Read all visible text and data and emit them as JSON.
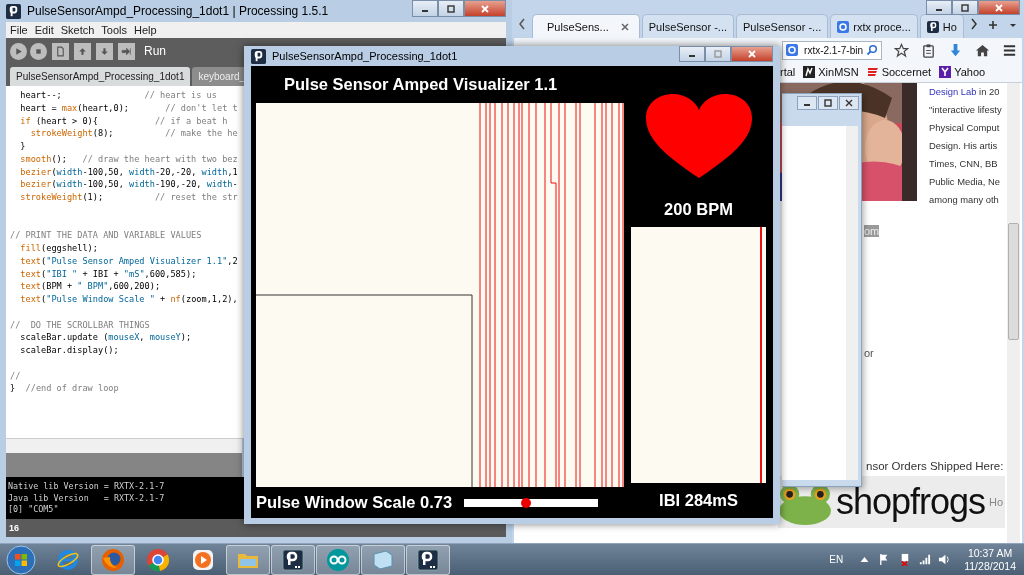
{
  "ide": {
    "title": "PulseSensorAmpd_Processing_1dot1 | Processing 1.5.1",
    "menu": [
      "File",
      "Edit",
      "Sketch",
      "Tools",
      "Help"
    ],
    "run_label": "Run",
    "tabs": [
      {
        "label": "PulseSensorAmpd_Processing_1dot1",
        "selected": true
      },
      {
        "label": "keyboard_",
        "selected": false
      }
    ],
    "code_blocks": [
      [
        [
          {
            "kind": "plain",
            "text": "  heart--;                "
          },
          {
            "kind": "comment",
            "text": "// heart is us"
          }
        ],
        [
          {
            "kind": "plain",
            "text": "  heart = "
          },
          {
            "kind": "keyword",
            "text": "max"
          },
          {
            "kind": "plain",
            "text": "(heart,0);       "
          },
          {
            "kind": "comment",
            "text": "// don't let t"
          }
        ],
        [
          {
            "kind": "keyword",
            "text": "  if"
          },
          {
            "kind": "plain",
            "text": " (heart > 0){           "
          },
          {
            "kind": "comment",
            "text": "// if a beat h"
          }
        ],
        [
          {
            "kind": "keyword",
            "text": "    strokeWeight"
          },
          {
            "kind": "plain",
            "text": "(8);          "
          },
          {
            "kind": "comment",
            "text": "// make the he"
          }
        ],
        [
          {
            "kind": "plain",
            "text": "  }"
          }
        ],
        [
          {
            "kind": "keyword",
            "text": "  smooth"
          },
          {
            "kind": "plain",
            "text": "();   "
          },
          {
            "kind": "comment",
            "text": "// draw the heart with two bez"
          }
        ],
        [
          {
            "kind": "keyword",
            "text": "  bezier"
          },
          {
            "kind": "plain",
            "text": "("
          },
          {
            "kind": "variable",
            "text": "width"
          },
          {
            "kind": "plain",
            "text": "-100,50, "
          },
          {
            "kind": "variable",
            "text": "width"
          },
          {
            "kind": "plain",
            "text": "-20,-20, "
          },
          {
            "kind": "variable",
            "text": "width"
          },
          {
            "kind": "plain",
            "text": ",1"
          }
        ],
        [
          {
            "kind": "keyword",
            "text": "  bezier"
          },
          {
            "kind": "plain",
            "text": "("
          },
          {
            "kind": "variable",
            "text": "width"
          },
          {
            "kind": "plain",
            "text": "-100,50, "
          },
          {
            "kind": "variable",
            "text": "width"
          },
          {
            "kind": "plain",
            "text": "-190,-20, "
          },
          {
            "kind": "variable",
            "text": "width"
          },
          {
            "kind": "plain",
            "text": "-"
          }
        ],
        [
          {
            "kind": "keyword",
            "text": "  strokeWeight"
          },
          {
            "kind": "plain",
            "text": "(1);          "
          },
          {
            "kind": "comment",
            "text": "// reset the str"
          }
        ]
      ],
      [
        [
          {
            "kind": "comment",
            "text": "// PRINT THE DATA AND VARIABLE VALUES"
          }
        ],
        [
          {
            "kind": "keyword",
            "text": "  fill"
          },
          {
            "kind": "plain",
            "text": "(eggshell);"
          }
        ],
        [
          {
            "kind": "keyword",
            "text": "  text"
          },
          {
            "kind": "plain",
            "text": "("
          },
          {
            "kind": "string",
            "text": "\"Pulse Sensor Amped Visualizer 1.1\""
          },
          {
            "kind": "plain",
            "text": ",2"
          }
        ],
        [
          {
            "kind": "keyword",
            "text": "  text"
          },
          {
            "kind": "plain",
            "text": "("
          },
          {
            "kind": "string",
            "text": "\"IBI \""
          },
          {
            "kind": "plain",
            "text": " + IBI + "
          },
          {
            "kind": "string",
            "text": "\"mS\""
          },
          {
            "kind": "plain",
            "text": ",600,585);"
          }
        ],
        [
          {
            "kind": "keyword",
            "text": "  text"
          },
          {
            "kind": "plain",
            "text": "(BPM + "
          },
          {
            "kind": "string",
            "text": "\" BPM\""
          },
          {
            "kind": "plain",
            "text": ",600,200);"
          }
        ],
        [
          {
            "kind": "keyword",
            "text": "  text"
          },
          {
            "kind": "plain",
            "text": "("
          },
          {
            "kind": "string",
            "text": "\"Pulse Window Scale \""
          },
          {
            "kind": "plain",
            "text": " + "
          },
          {
            "kind": "keyword",
            "text": "nf"
          },
          {
            "kind": "plain",
            "text": "(zoom,1,2),"
          }
        ]
      ],
      [
        [
          {
            "kind": "comment",
            "text": "//  DO THE SCROLLBAR THINGS"
          }
        ],
        [
          {
            "kind": "plain",
            "text": "  scaleBar.update ("
          },
          {
            "kind": "variable",
            "text": "mouseX"
          },
          {
            "kind": "plain",
            "text": ", "
          },
          {
            "kind": "variable",
            "text": "mouseY"
          },
          {
            "kind": "plain",
            "text": ");"
          }
        ],
        [
          {
            "kind": "plain",
            "text": "  scaleBar.display();"
          }
        ]
      ],
      [
        [
          {
            "kind": "comment",
            "text": "//"
          }
        ],
        [
          {
            "kind": "plain",
            "text": "}  "
          },
          {
            "kind": "comment",
            "text": "//end of draw loop"
          }
        ]
      ]
    ],
    "console": [
      "Native lib Version = RXTX-2.1-7",
      "Java lib Version   = RXTX-2.1-7",
      "[0] \"COM5\""
    ],
    "status_line": "16"
  },
  "sketch": {
    "title": "PulseSensorAmpd_Processing_1dot1",
    "heading": "Pulse Sensor Amped Visualizer 1.1",
    "bpm": "200 BPM",
    "scale_label": "Pulse Window Scale 0.73",
    "scale_slider": {
      "level": 0.46
    },
    "ibi": "IBI 284mS"
  },
  "browser": {
    "tabs": [
      {
        "label": "PulseSens...",
        "kind": "page",
        "selected": true
      },
      {
        "label": "PulseSensor -...",
        "kind": "page",
        "selected": false
      },
      {
        "label": "PulseSensor -...",
        "kind": "page",
        "selected": false
      },
      {
        "label": "rxtx proce...",
        "kind": "search",
        "selected": false
      },
      {
        "label": "Ho",
        "kind": "processing",
        "selected": false
      }
    ],
    "search": {
      "value": "rxtx-2.1-7-bin"
    },
    "bookmarks": [
      {
        "label": "rtal",
        "kind": "plain"
      },
      {
        "label": "XinMSN",
        "kind": "msn"
      },
      {
        "label": "Soccernet",
        "kind": "espn"
      },
      {
        "label": "Yahoo",
        "kind": "yahoo"
      }
    ],
    "bio_link": "Design Lab",
    "bio_first": "in 20",
    "bio_lines": [
      "\"interactive lifesty",
      "Physical Comput",
      "Design.  His artis",
      "Times, CNN, BB",
      "Public Media, Ne",
      "among many oth"
    ],
    "highlighted_fragment": "om",
    "fragment": "or",
    "orders_heading": "nsor Orders Shipped Here:",
    "banner": {
      "logo": "shopfrogs",
      "side": "Ho"
    }
  },
  "taskbar": {
    "apps": [
      {
        "kind": "ie",
        "active": false
      },
      {
        "kind": "firefox",
        "active": true
      },
      {
        "kind": "chrome",
        "active": false
      },
      {
        "kind": "media",
        "active": false
      },
      {
        "kind": "folder",
        "active": true
      },
      {
        "kind": "processing",
        "active": true
      },
      {
        "kind": "arduino",
        "active": true
      },
      {
        "kind": "notepad",
        "active": true
      },
      {
        "kind": "processing",
        "active": true
      }
    ],
    "language": "EN",
    "time": "10:37 AM",
    "date": "11/28/2014"
  }
}
